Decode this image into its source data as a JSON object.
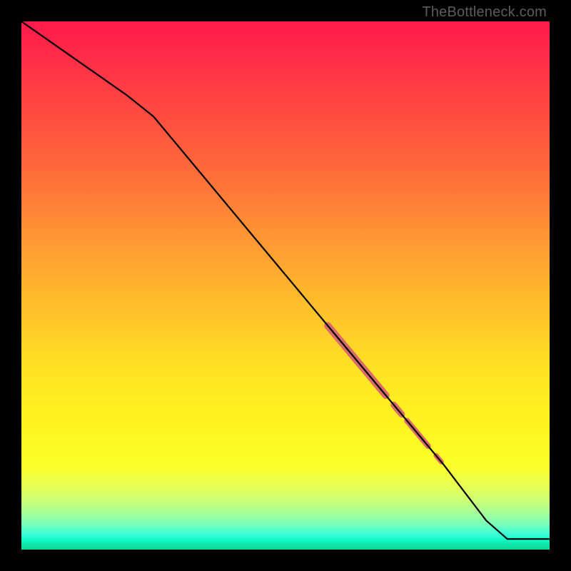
{
  "attribution": "TheBottleneck.com",
  "colors": {
    "page_bg": "#000000",
    "line": "#000000",
    "accent": "#d96b6b",
    "gradient_top": "#ff1a4b",
    "gradient_bottom": "#0cd893"
  },
  "chart_data": {
    "type": "line",
    "title": "",
    "xlabel": "",
    "ylabel": "",
    "xlim": [
      0,
      100
    ],
    "ylim": [
      0,
      100
    ],
    "grid": false,
    "legend": false,
    "series": [
      {
        "name": "curve",
        "x": [
          0,
          10,
          20,
          25,
          30,
          40,
          50,
          60,
          70,
          80,
          88,
          92,
          100
        ],
        "y": [
          100,
          93,
          86,
          82,
          76,
          64,
          52,
          40,
          28,
          16,
          5.5,
          2,
          2
        ]
      }
    ],
    "accent_segments": [
      {
        "x0": 58,
        "x1": 69,
        "thickness": 10
      },
      {
        "x0": 70.5,
        "x1": 72,
        "thickness": 9
      },
      {
        "x0": 73,
        "x1": 77,
        "thickness": 8
      },
      {
        "x0": 78.5,
        "x1": 79.5,
        "thickness": 7
      }
    ]
  }
}
